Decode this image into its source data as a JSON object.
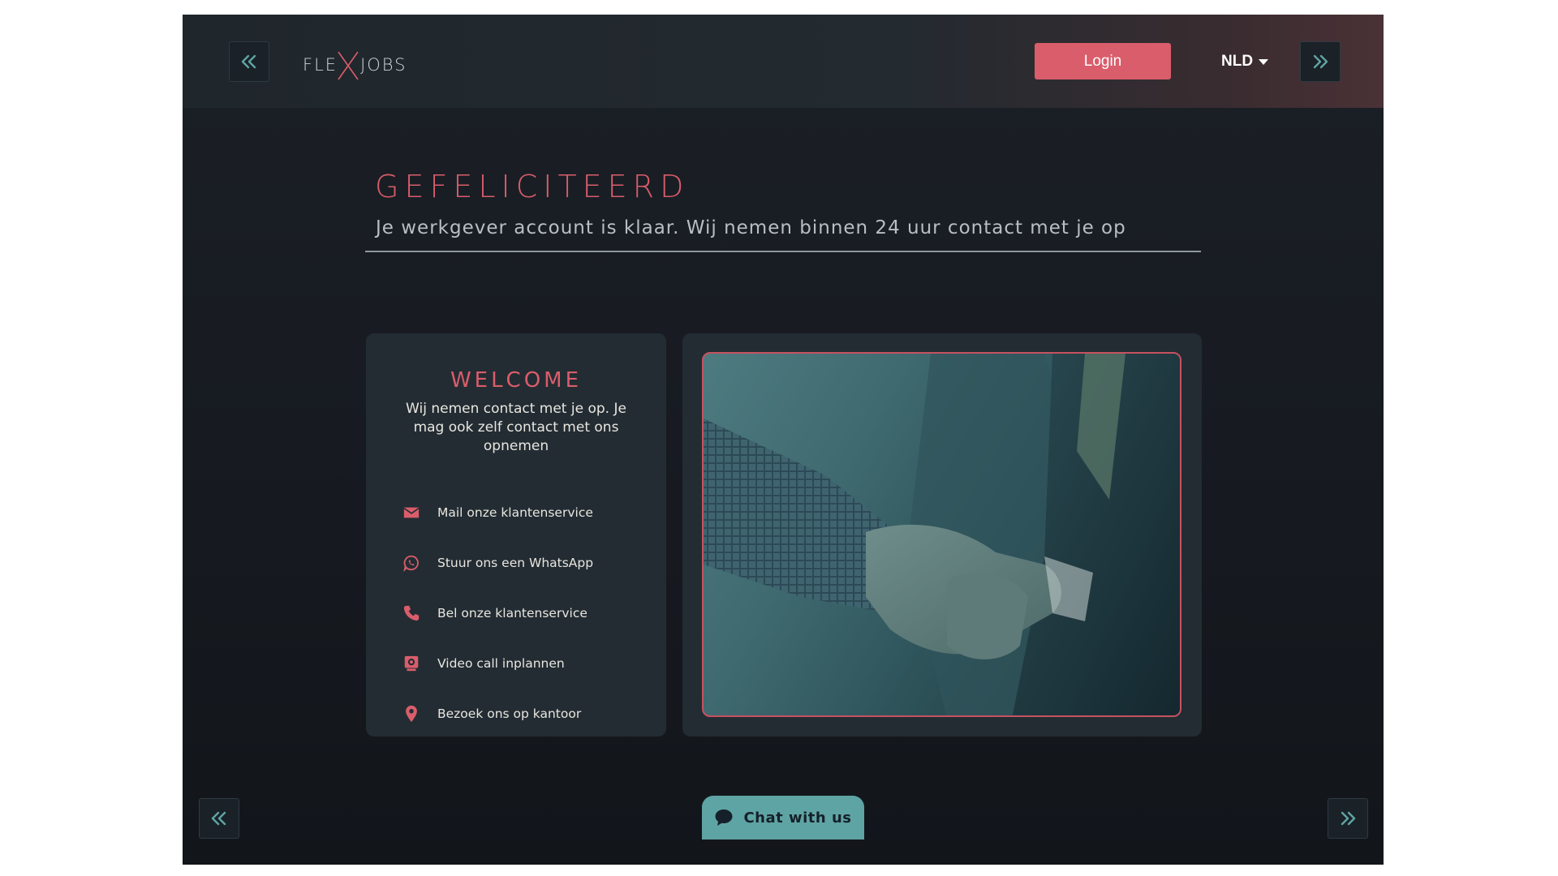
{
  "colors": {
    "accent": "#d95d6b",
    "teal": "#5fa4a4",
    "panel": "#232c33",
    "background": "#161a20"
  },
  "header": {
    "logo_text_left": "FLE",
    "logo_text_right": "JOBS",
    "login_label": "Login",
    "language": "NLD",
    "nav_prev_icon": "double-chevron-left-icon",
    "nav_next_icon": "double-chevron-right-icon"
  },
  "main": {
    "heading": "GEFELICITEERD",
    "subheading": "Je werkgever account is klaar. Wij nemen binnen 24 uur contact met je op"
  },
  "welcome_card": {
    "title": "WELCOME",
    "text": "Wij nemen contact met je op. Je mag ook zelf contact met ons opnemen",
    "items": [
      {
        "icon": "mail-icon",
        "label": "Mail onze klantenservice"
      },
      {
        "icon": "whatsapp-icon",
        "label": "Stuur ons een WhatsApp"
      },
      {
        "icon": "phone-icon",
        "label": "Bel onze klantenservice"
      },
      {
        "icon": "webcam-icon",
        "label": "Video call inplannen"
      },
      {
        "icon": "location-pin-icon",
        "label": "Bezoek ons op kantoor"
      }
    ]
  },
  "image_card": {
    "image": "handshake-photo"
  },
  "footer": {
    "chat_label": "Chat with us",
    "chat_icon": "chat-bubble-icon"
  }
}
